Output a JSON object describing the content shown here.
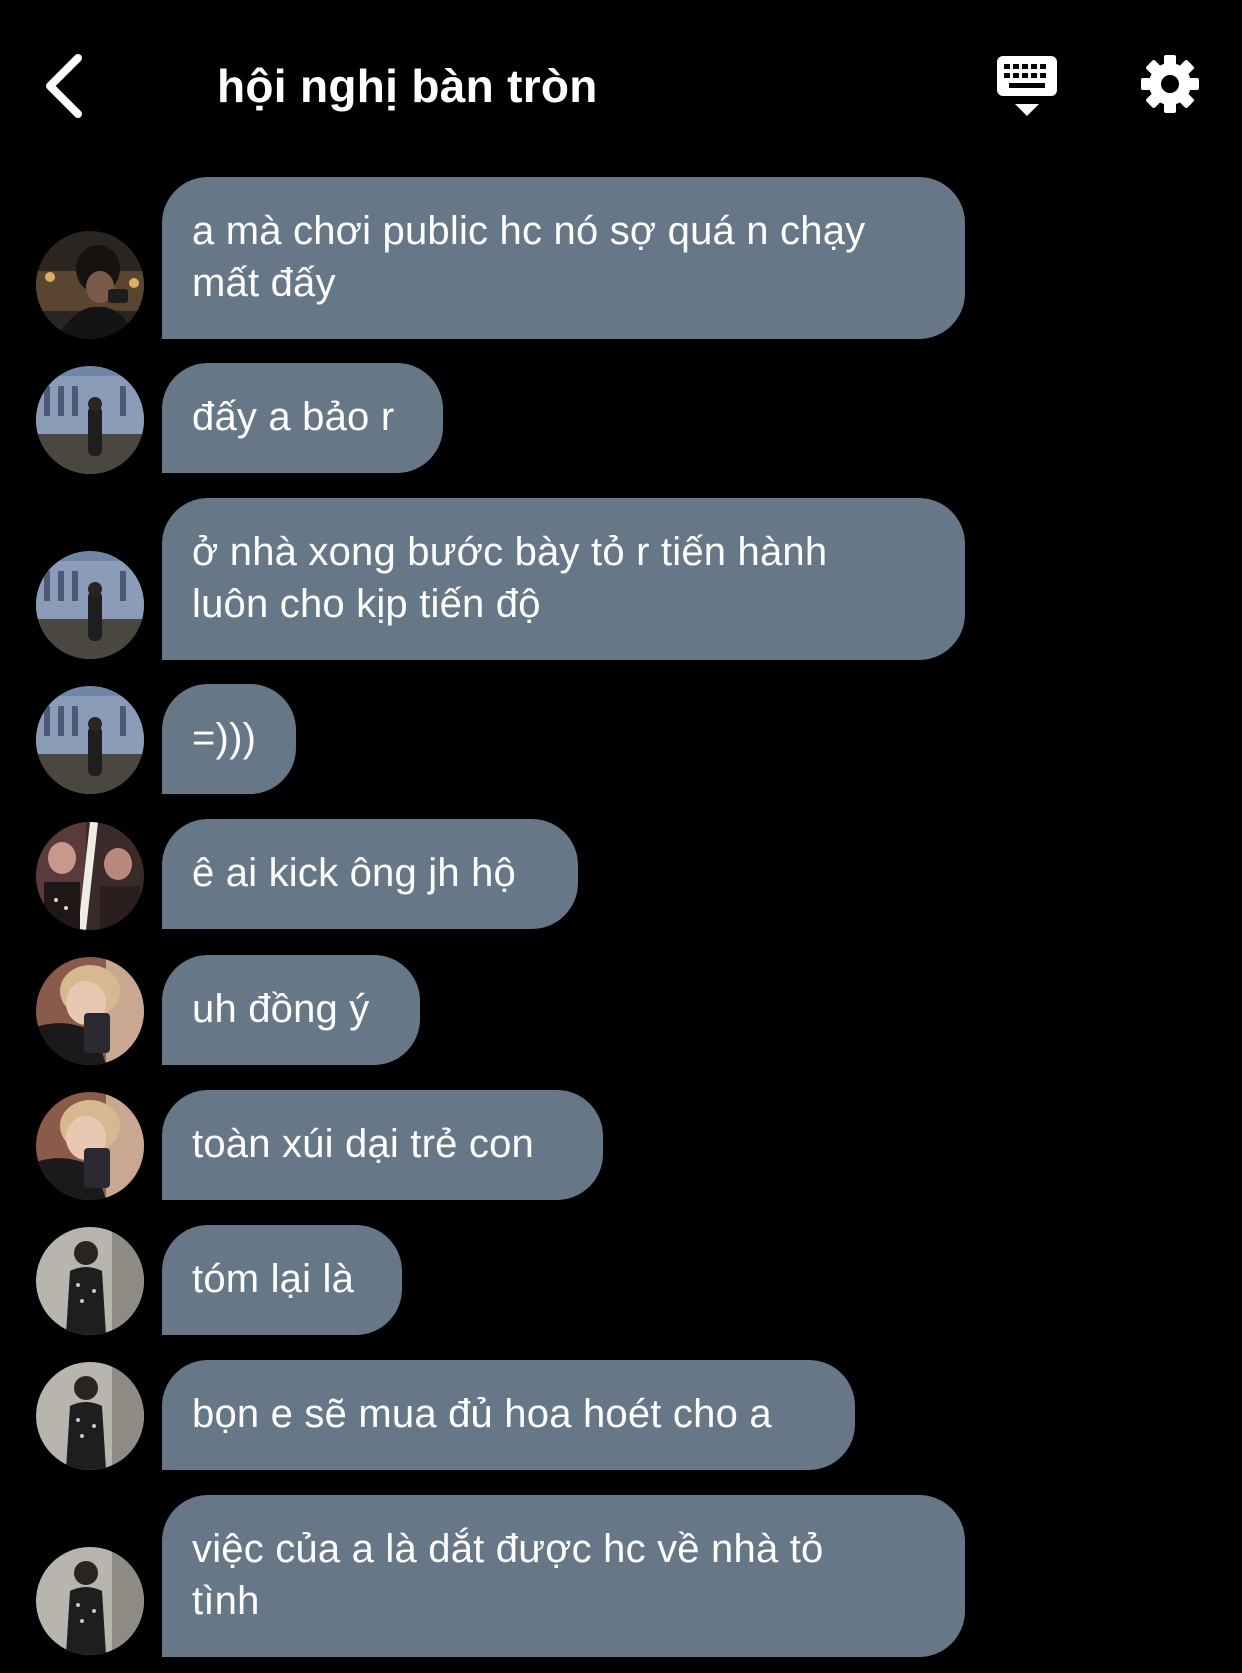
{
  "header": {
    "title": "hội nghị bàn tròn",
    "back_icon": "chevron-left-icon",
    "keyboard_icon": "keyboard-icon",
    "settings_icon": "gear-icon"
  },
  "colors": {
    "background": "#000000",
    "bubble": "#667788",
    "text": "#ffffff"
  },
  "messages": [
    {
      "avatar": "user-1",
      "text": "a mà chơi public hc nó sợ quá n chạy\nmất đấy"
    },
    {
      "avatar": "user-2",
      "text": "đấy a bảo r"
    },
    {
      "avatar": "user-2",
      "text": "ở nhà xong bước bày tỏ r tiến hành\nluôn cho kịp tiến độ"
    },
    {
      "avatar": "user-2",
      "text": "=)))"
    },
    {
      "avatar": "user-3",
      "text": "ê ai kick ông jh hộ"
    },
    {
      "avatar": "user-4",
      "text": "uh đồng ý"
    },
    {
      "avatar": "user-4",
      "text": "toàn xúi dại trẻ con"
    },
    {
      "avatar": "user-5",
      "text": "tóm lại là"
    },
    {
      "avatar": "user-5",
      "text": "bọn e sẽ mua đủ hoa hoét cho a"
    },
    {
      "avatar": "user-5",
      "text": "việc của a là dắt được hc về nhà tỏ\ntình"
    }
  ]
}
